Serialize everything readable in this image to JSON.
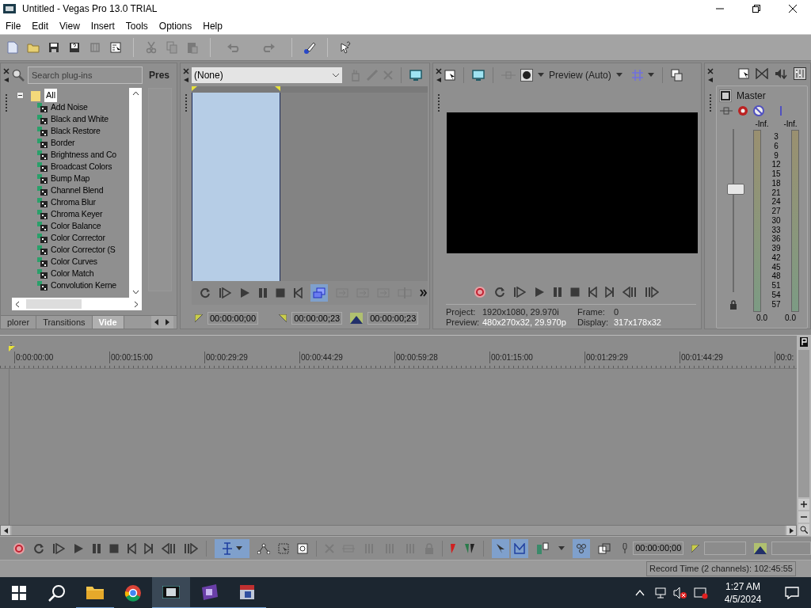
{
  "window": {
    "title": "Untitled - Vegas Pro 13.0 TRIAL"
  },
  "menu": [
    "File",
    "Edit",
    "View",
    "Insert",
    "Tools",
    "Options",
    "Help"
  ],
  "explorer": {
    "search": {
      "placeholder": "Search plug-ins"
    },
    "presets_label": "Pres",
    "tree": [
      {
        "label": "All",
        "selected": true,
        "expanded": true,
        "children": [
          {
            "label": "Add Noise",
            "selected": false
          },
          {
            "label": "Black and White",
            "selected": false
          },
          {
            "label": "Black Restore",
            "selected": false
          },
          {
            "label": "Border",
            "selected": false
          },
          {
            "label": "Brightness and Co",
            "selected": false
          },
          {
            "label": "Broadcast Colors",
            "selected": false
          },
          {
            "label": "Bump Map",
            "selected": false
          },
          {
            "label": "Channel Blend",
            "selected": false
          },
          {
            "label": "Chroma Blur",
            "selected": false
          },
          {
            "label": "Chroma Keyer",
            "selected": false
          },
          {
            "label": "Color Balance",
            "selected": false
          },
          {
            "label": "Color Corrector",
            "selected": false
          },
          {
            "label": "Color Corrector (S",
            "selected": false
          },
          {
            "label": "Color Curves",
            "selected": false
          },
          {
            "label": "Color Match",
            "selected": false
          },
          {
            "label": "Convolution Kerne",
            "selected": false
          }
        ]
      }
    ],
    "tabs": [
      {
        "label": "plorer",
        "selected": false
      },
      {
        "label": "Transitions",
        "selected": false
      },
      {
        "label": "Vide",
        "selected": true
      }
    ]
  },
  "trimmer": {
    "dropdown": {
      "value": "(None)"
    },
    "times": [
      "00:00:00;00",
      "00:00:00;23",
      "00:00:00;23"
    ]
  },
  "preview": {
    "quality": "Preview (Auto)",
    "info": [
      {
        "label": "Project:",
        "value": "1920x1080, 29.970i"
      },
      {
        "label": "Frame:",
        "value": "0"
      },
      {
        "label": "Preview:",
        "value": "480x270x32, 29.970p"
      },
      {
        "label": "Display:",
        "value": "317x178x32"
      }
    ]
  },
  "master": {
    "title": "Master",
    "peaks": [
      "-Inf.",
      "-Inf."
    ],
    "scale": [
      "3",
      "6",
      "9",
      "12",
      "15",
      "18",
      "21",
      "24",
      "27",
      "30",
      "33",
      "36",
      "39",
      "42",
      "45",
      "48",
      "51",
      "54",
      "57"
    ],
    "fader": {
      "level": 0.63
    },
    "readings": [
      "0.0",
      "0.0"
    ]
  },
  "timeline": {
    "ruler": [
      "0:00:00:00",
      "00:00:15:00",
      "00:00:29:29",
      "00:00:44:29",
      "00:00:59:28",
      "00:01:15:00",
      "00:01:29:29",
      "00:01:44:29",
      "00:0:"
    ],
    "cursor_time": "00:00:00;00"
  },
  "status_bar": "Record Time (2 channels): 102:45:55",
  "taskbar": {
    "time": "1:27 AM",
    "date": "4/5/2024"
  }
}
